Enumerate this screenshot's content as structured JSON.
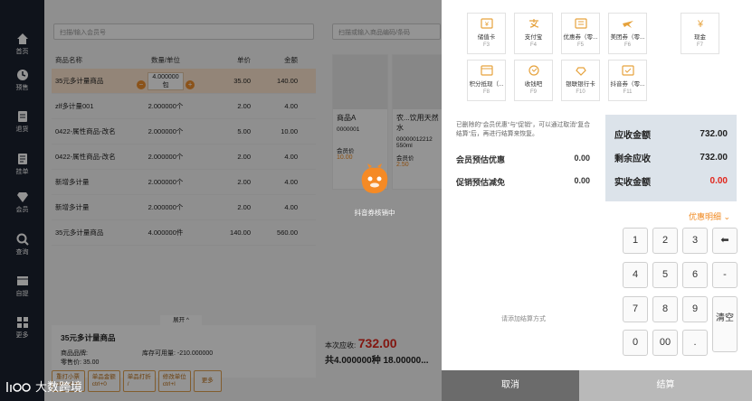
{
  "sidebar": {
    "items": [
      {
        "label": "首页",
        "icon": "home-icon"
      },
      {
        "label": "预售",
        "icon": "clock-icon"
      },
      {
        "label": "退货",
        "icon": "return-icon"
      },
      {
        "label": "挂单",
        "icon": "order-icon"
      },
      {
        "label": "会员",
        "icon": "diamond-icon"
      },
      {
        "label": "查询",
        "icon": "search-icon"
      },
      {
        "label": "自提",
        "icon": "pickup-icon"
      },
      {
        "label": "更多",
        "icon": "grid-icon"
      }
    ]
  },
  "pos": {
    "member_search_placeholder": "扫描/输入会员号",
    "goods_search_placeholder": "扫描或输入商品编码/条码",
    "columns": [
      "商品名称",
      "数量/单位",
      "单价",
      "金额"
    ],
    "rows": [
      {
        "name": "35元多计量商品",
        "qty": "4.000000",
        "unit_sub": "包",
        "price": "35.00",
        "amount": "140.00",
        "selected": true
      },
      {
        "name": "zlf多计量001",
        "qty": "2.000000个",
        "unit_sub": "",
        "price": "2.00",
        "amount": "4.00"
      },
      {
        "name": "0422-属性商品-改名",
        "qty": "2.000000个",
        "unit_sub": "",
        "price": "5.00",
        "amount": "10.00"
      },
      {
        "name": "0422-属性商品-改名",
        "qty": "2.000000个",
        "unit_sub": "",
        "price": "2.00",
        "amount": "4.00"
      },
      {
        "name": "新增多计量",
        "qty": "2.000000个",
        "unit_sub": "",
        "price": "2.00",
        "amount": "4.00"
      },
      {
        "name": "新增多计量",
        "qty": "2.000000个",
        "unit_sub": "",
        "price": "2.00",
        "amount": "4.00"
      },
      {
        "name": "35元多计量商品",
        "qty": "4.000000件",
        "unit_sub": "",
        "price": "140.00",
        "amount": "560.00"
      }
    ],
    "expand_label": "展开 ^",
    "detail": {
      "title": "35元多计量商品",
      "brand_label": "商品品牌:",
      "stock_label": "库存可用量:",
      "stock_value": "-210.000000",
      "last_line": "零售价: 35.00"
    },
    "action_buttons": [
      {
        "label": "重打小票",
        "key": "ctrl+alt+p"
      },
      {
        "label": "单品金额",
        "key": "ctrl+0"
      },
      {
        "label": "单品打折",
        "key": "/"
      },
      {
        "label": "修改单位",
        "key": "ctrl+l"
      },
      {
        "label": "更多",
        "key": ""
      }
    ],
    "goods": [
      {
        "name": "商品A",
        "code": "0000001",
        "member_price_label": "会员价",
        "member_price": "10.00"
      },
      {
        "name": "农...饮用天然水",
        "code": "00000012212",
        "spec": "550ml",
        "member_price_label": "会员价",
        "member_price": "2.50"
      }
    ],
    "total_label": "本次应收:",
    "total_value": "732.00",
    "total_sub": "共4.000000种 18.00000..."
  },
  "loading": {
    "text": "抖音券核销中"
  },
  "payments": [
    {
      "label": "储值卡",
      "key": "F3",
      "color": "#e6a23c",
      "icon": "card-icon"
    },
    {
      "label": "支付宝",
      "key": "F4",
      "color": "#e6a23c",
      "icon": "alipay-icon"
    },
    {
      "label": "优惠券（零...",
      "key": "F5",
      "color": "#e6a23c",
      "icon": "coupon-icon"
    },
    {
      "label": "美团券（零...",
      "key": "F6",
      "color": "#e6a23c",
      "icon": "meituan-icon"
    },
    {
      "label": "现金",
      "key": "F7",
      "color": "#e6a23c",
      "icon": "cash-icon"
    },
    {
      "label": "积分抵现（...",
      "key": "F8",
      "color": "#e6a23c",
      "icon": "points-icon"
    },
    {
      "label": "收钱吧",
      "key": "F9",
      "color": "#e6a23c",
      "icon": "shouqianba-icon"
    },
    {
      "label": "银联银行卡",
      "key": "F10",
      "color": "#e6a23c",
      "icon": "unionpay-icon"
    },
    {
      "label": "抖音券（零...",
      "key": "F11",
      "color": "#e6a23c",
      "icon": "douyin-icon"
    }
  ],
  "note": "已删除的\"会员优惠\"与\"促销\"，可以通过取消\"复合结算\"后，再进行结算来恢复。",
  "discounts": [
    {
      "label": "会员预估优惠",
      "value": "0.00"
    },
    {
      "label": "促销预估减免",
      "value": "0.00"
    }
  ],
  "summary": [
    {
      "label": "应收金额",
      "value": "732.00",
      "red": false
    },
    {
      "label": "剩余应收",
      "value": "732.00",
      "red": false
    },
    {
      "label": "实收金额",
      "value": "0.00",
      "red": true
    }
  ],
  "detail_link": "优惠明细",
  "hint": "请添加结算方式",
  "keypad": {
    "keys": [
      "1",
      "2",
      "3",
      "⬅",
      "4",
      "5",
      "6",
      "-",
      "7",
      "8",
      "9",
      "清空",
      "0",
      "00",
      "."
    ]
  },
  "footer": {
    "cancel": "取消",
    "settle": "结算"
  },
  "watermark": {
    "text": "大数跨境"
  }
}
